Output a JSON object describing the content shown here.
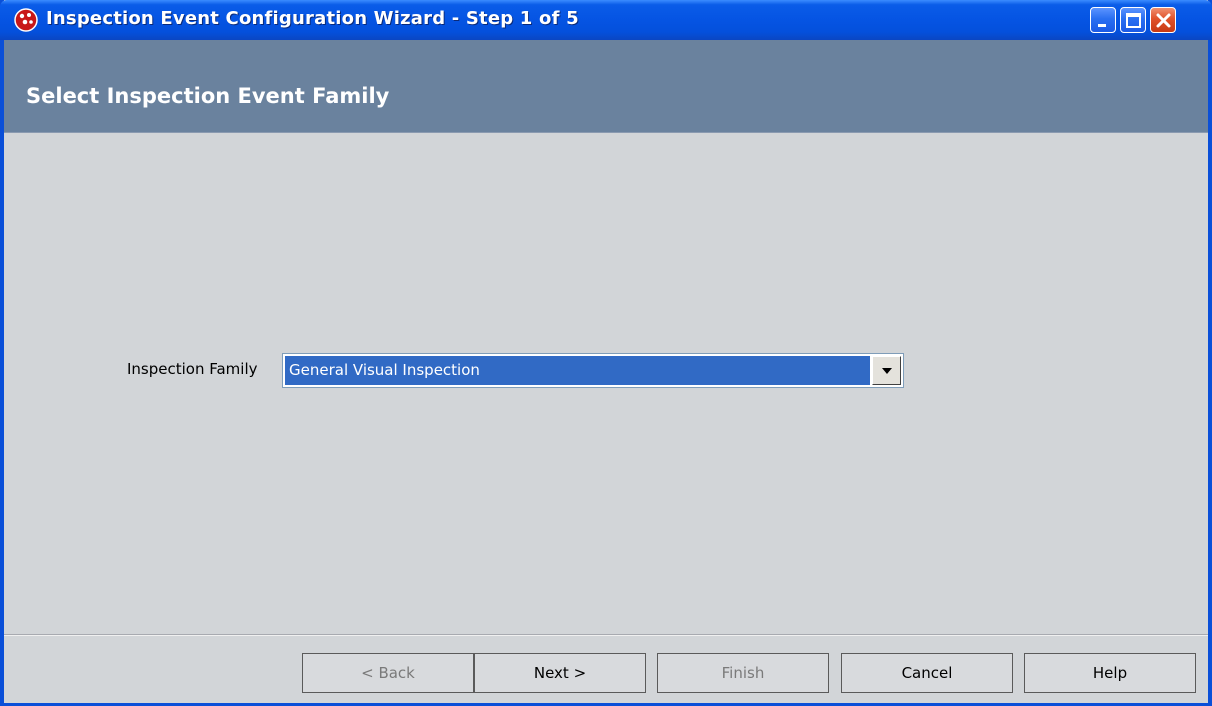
{
  "window": {
    "title": "Inspection Event Configuration Wizard - Step 1 of 5",
    "app_icon": "red-bubbles-icon",
    "controls": [
      "minimize-icon",
      "maximize-icon",
      "close-icon"
    ]
  },
  "header": {
    "title": "Select Inspection Event Family"
  },
  "form": {
    "inspection_family_label": "Inspection Family",
    "inspection_family_value": "General Visual Inspection"
  },
  "footer": {
    "back_label": "< Back",
    "next_label": "Next >",
    "finish_label": "Finish",
    "cancel_label": "Cancel",
    "help_label": "Help"
  },
  "colors": {
    "titlebar": "#0554e3",
    "header_bg": "#6a829e",
    "content_bg": "#d2d5d8",
    "selection": "#316ac5"
  }
}
